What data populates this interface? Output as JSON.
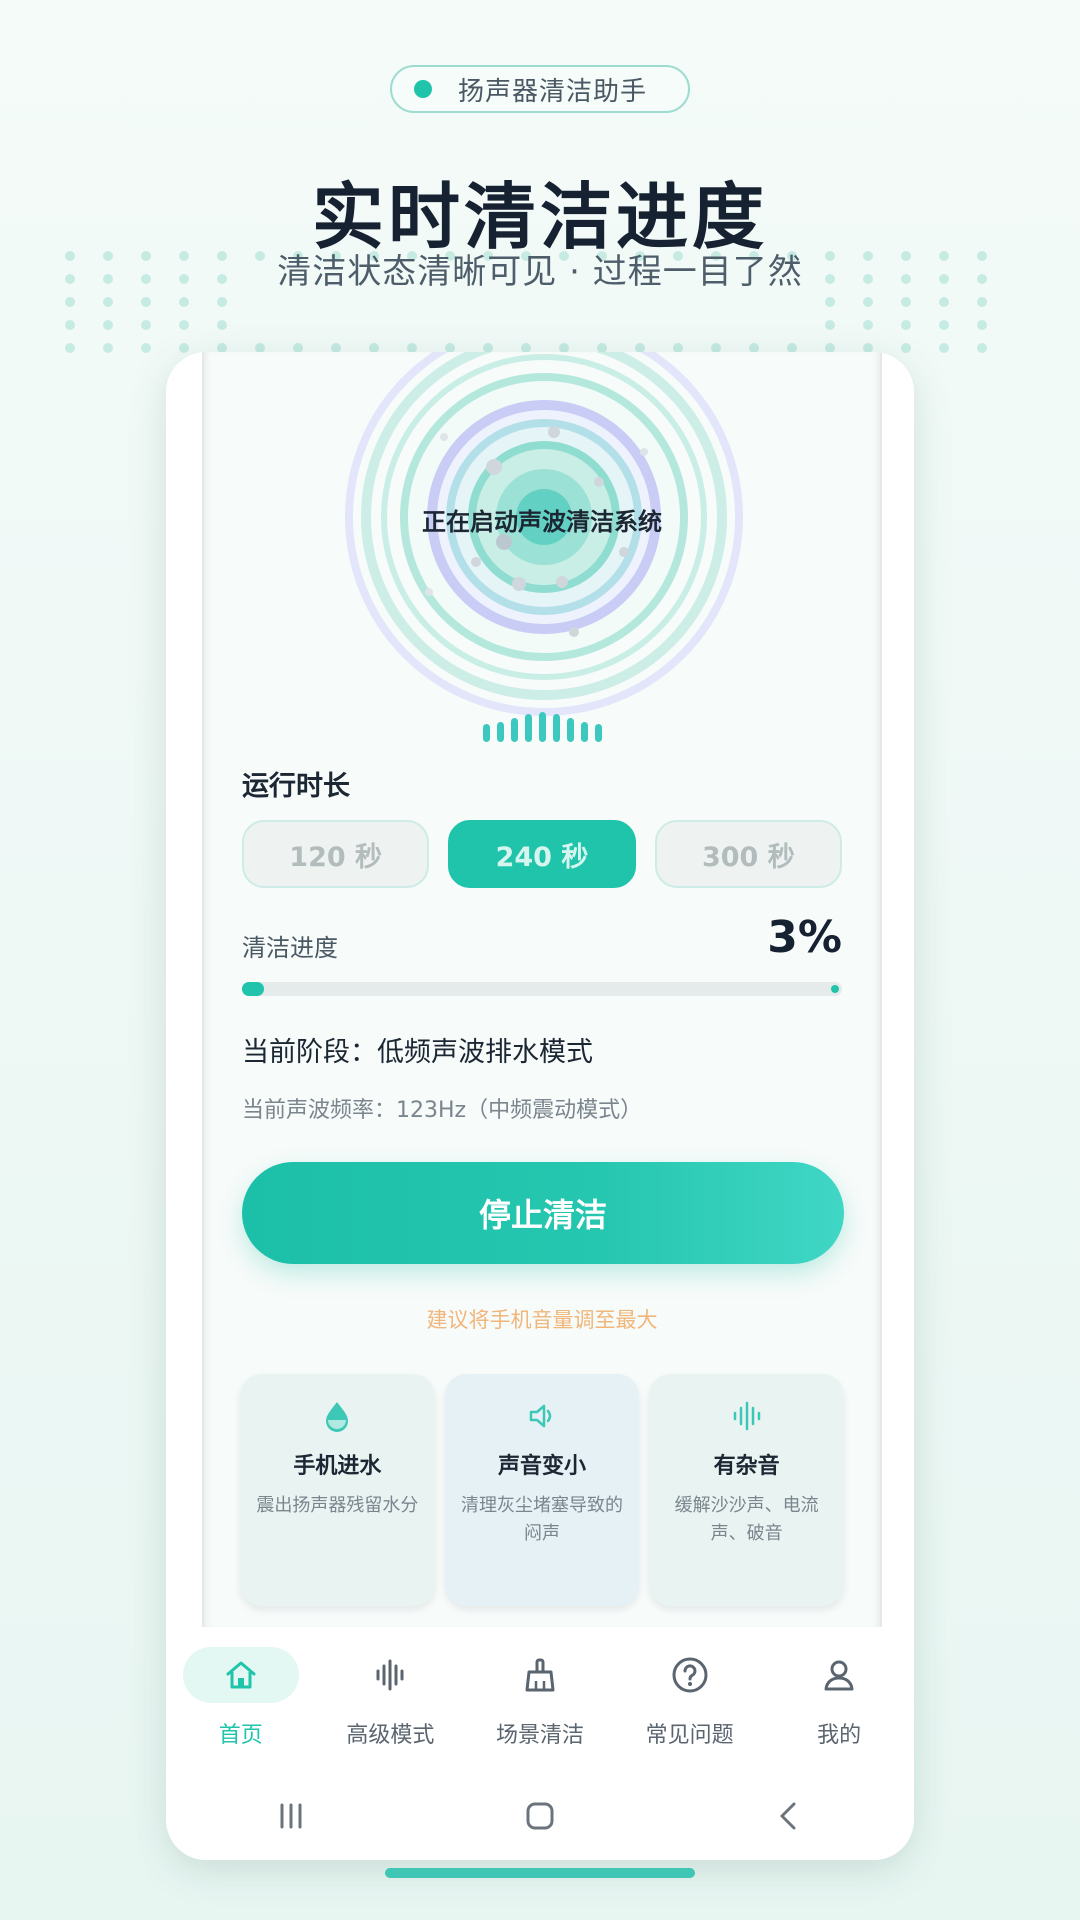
{
  "badge": {
    "text": "扬声器清洁助手"
  },
  "hero": {
    "title": "实时清洁进度",
    "subtitle": "清洁状态清晰可见 · 过程一目了然"
  },
  "screen": {
    "status_text": "正在启动声波清洁系统",
    "duration": {
      "label": "运行时长",
      "options": [
        "120 秒",
        "240 秒",
        "300 秒"
      ],
      "selected": "240 秒"
    },
    "progress": {
      "label": "清洁进度",
      "value_text": "3%",
      "fraction": 0.03
    },
    "stage": "当前阶段：低频声波排水模式",
    "frequency": "当前声波频率：123Hz（中频震动模式）",
    "stop_button": "停止清洁",
    "tip": "建议将手机音量调至最大",
    "cards": [
      {
        "icon": "water-drop-icon",
        "title": "手机进水",
        "desc": "震出扬声器残留水分"
      },
      {
        "icon": "speaker-icon",
        "title": "声音变小",
        "desc": "清理灰尘堵塞导致的闷声"
      },
      {
        "icon": "sound-wave-icon",
        "title": "有杂音",
        "desc": "缓解沙沙声、电流声、破音"
      }
    ]
  },
  "tabbar": {
    "items": [
      {
        "label": "首页",
        "icon": "home-icon",
        "active": true
      },
      {
        "label": "高级模式",
        "icon": "sound-wave-icon",
        "active": false
      },
      {
        "label": "场景清洁",
        "icon": "broom-icon",
        "active": false
      },
      {
        "label": "常见问题",
        "icon": "help-icon",
        "active": false
      },
      {
        "label": "我的",
        "icon": "user-icon",
        "active": false
      }
    ]
  },
  "system_nav": {
    "icons": [
      "recent-apps-icon",
      "home-button-icon",
      "back-icon"
    ]
  },
  "colors": {
    "accent": "#1fc4aa",
    "tip": "#f0b67a",
    "title": "#162231"
  }
}
